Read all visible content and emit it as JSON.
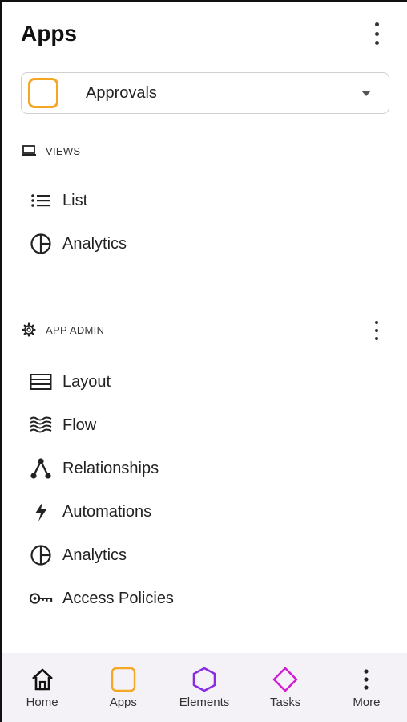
{
  "header": {
    "title": "Apps"
  },
  "app_selector": {
    "value": "Approvals",
    "icon": "app-square-icon",
    "accent": "#f5a623"
  },
  "views": {
    "label": "VIEWS",
    "items": [
      {
        "label": "List",
        "icon": "list-icon"
      },
      {
        "label": "Analytics",
        "icon": "analytics-icon"
      }
    ]
  },
  "admin": {
    "label": "APP ADMIN",
    "items": [
      {
        "label": "Layout",
        "icon": "layout-icon"
      },
      {
        "label": "Flow",
        "icon": "flow-icon"
      },
      {
        "label": "Relationships",
        "icon": "relationships-icon"
      },
      {
        "label": "Automations",
        "icon": "lightning-icon"
      },
      {
        "label": "Analytics",
        "icon": "analytics-icon"
      },
      {
        "label": "Access Policies",
        "icon": "key-icon"
      }
    ]
  },
  "bottom_nav": [
    {
      "label": "Home",
      "icon": "home-icon"
    },
    {
      "label": "Apps",
      "icon": "apps-icon",
      "color": "#f5a623"
    },
    {
      "label": "Elements",
      "icon": "hexagon-icon",
      "color": "#8a2be2"
    },
    {
      "label": "Tasks",
      "icon": "diamond-icon",
      "color": "#d21fd2"
    },
    {
      "label": "More",
      "icon": "more-icon"
    }
  ]
}
